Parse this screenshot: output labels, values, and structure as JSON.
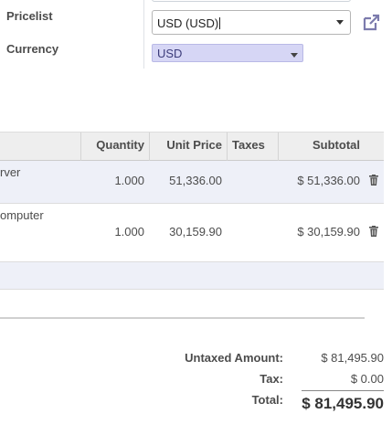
{
  "form": {
    "pricelist_label": "Pricelist",
    "pricelist_value": "USD (USD)",
    "currency_label": "Currency",
    "currency_value": "USD"
  },
  "table": {
    "headers": {
      "quantity": "Quantity",
      "unit_price": "Unit Price",
      "taxes": "Taxes",
      "subtotal": "Subtotal"
    },
    "rows": [
      {
        "name": "rver",
        "quantity": "1.000",
        "unit_price": "51,336.00",
        "taxes": "",
        "subtotal": "$ 51,336.00"
      },
      {
        "name": "omputer",
        "quantity": "1.000",
        "unit_price": "30,159.90",
        "taxes": "",
        "subtotal": "$ 30,159.90"
      }
    ]
  },
  "totals": {
    "untaxed_label": "Untaxed Amount:",
    "untaxed_value": "$ 81,495.90",
    "tax_label": "Tax:",
    "tax_value": "$ 0.00",
    "total_label": "Total:",
    "total_value": "$ 81,495.90"
  },
  "icons": {
    "external_link": "external-link-icon",
    "delete": "trash-icon"
  },
  "colors": {
    "accent": "#875a7b",
    "currency_highlight": "#d6d6f5",
    "selected_row": "#eef0f8"
  }
}
